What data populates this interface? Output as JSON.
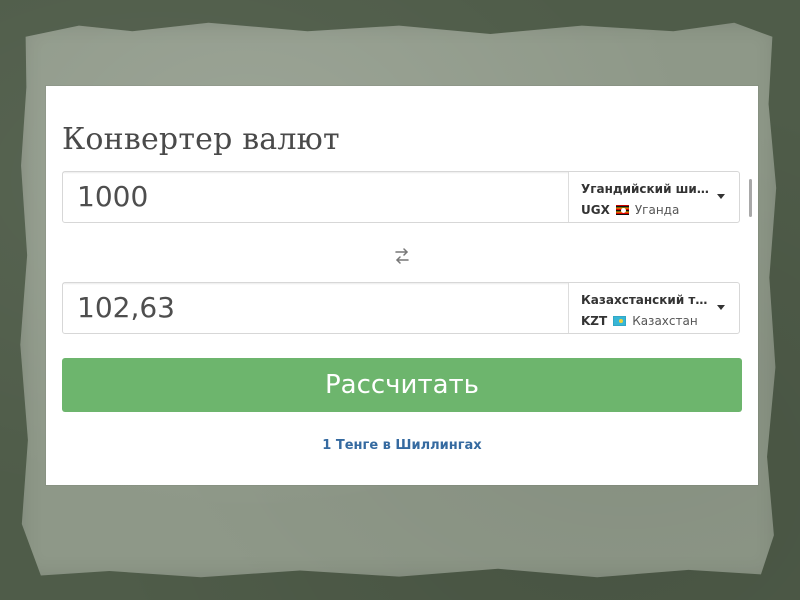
{
  "title": "Конвертер валют",
  "from": {
    "amount": "1000",
    "currency_name": "Угандийский шилл...",
    "code": "UGX",
    "country": "Уганда",
    "flag_icon": "uganda-flag-icon"
  },
  "to": {
    "amount": "102,63",
    "currency_name": "Казахстанский тенге",
    "code": "KZT",
    "country": "Казахстан",
    "flag_icon": "kazakhstan-flag-icon"
  },
  "swap_icon": "swap-arrows-icon",
  "calculate_button": "Рассчитать",
  "rate_link": "1 Тенге в Шиллингах",
  "colors": {
    "background": "#4f5c49",
    "paper": "#8e9888",
    "card": "#ffffff",
    "button": "#6db56d",
    "link": "#356aa0",
    "text": "#4a4a4a"
  }
}
